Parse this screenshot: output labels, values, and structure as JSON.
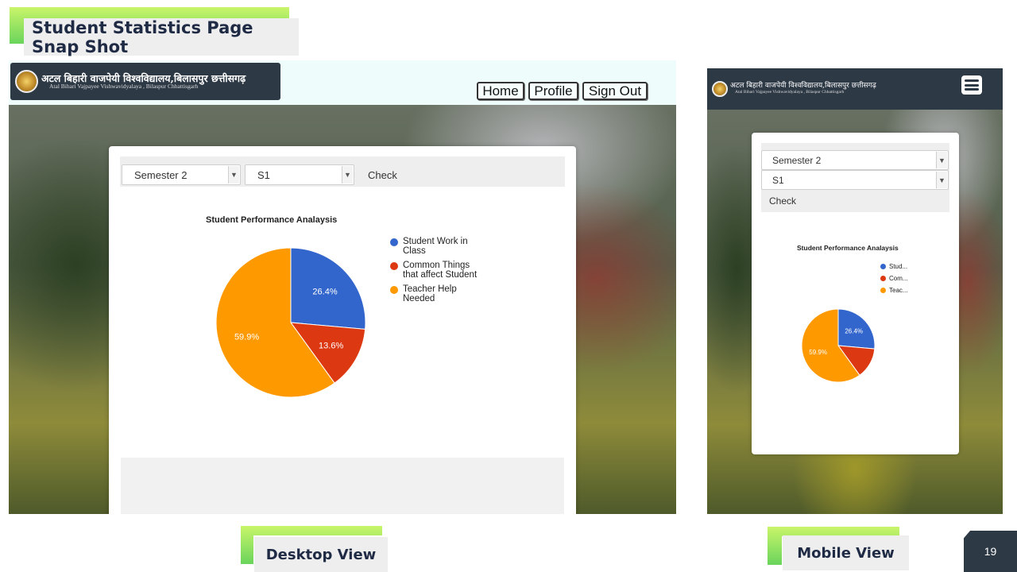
{
  "slide": {
    "title": "Student Statistics Page Snap Shot",
    "desktop_caption": "Desktop View",
    "mobile_caption": "Mobile View",
    "page_number": "19"
  },
  "site": {
    "name_hindi": "अटल बिहारी वाजपेयी विश्वविद्यालय,बिलासपुर छत्तीसगढ़",
    "name_english": "Atal Bihari Vajpayee Vishwavidyalaya , Bilaspur Chhattisgarh",
    "nav": {
      "home": "Home",
      "profile": "Profile",
      "sign_out": "Sign Out"
    }
  },
  "filters": {
    "semester": "Semester 2",
    "section": "S1",
    "check_label": "Check"
  },
  "mobile_legend": [
    "Stud...",
    "Com...",
    "Teac..."
  ],
  "colors": {
    "blue": "#3366cc",
    "red": "#dc3912",
    "orange": "#ff9900",
    "accent_green": "#6ad45c",
    "header_dark": "#2e3946"
  },
  "icons": {
    "menu": "hamburger-icon",
    "dropdown": "chevron-down-icon",
    "logo": "university-emblem"
  },
  "chart_data": [
    {
      "type": "pie",
      "view": "desktop",
      "title": "Student Performance Analaysis",
      "labels": [
        "Student Work in Class",
        "Common Things that affect Student",
        "Teacher Help Needed"
      ],
      "values": [
        26.4,
        13.6,
        59.9
      ],
      "value_labels": [
        "26.4%",
        "13.6%",
        "59.9%"
      ],
      "colors": [
        "#3366cc",
        "#dc3912",
        "#ff9900"
      ],
      "legend_position": "right"
    },
    {
      "type": "pie",
      "view": "mobile",
      "title": "Student Performance Analaysis",
      "labels": [
        "Stud...",
        "Com...",
        "Teac..."
      ],
      "values": [
        26.4,
        13.6,
        59.9
      ],
      "value_labels": [
        "26.4%",
        "",
        "59.9%"
      ],
      "colors": [
        "#3366cc",
        "#dc3912",
        "#ff9900"
      ],
      "legend_position": "top-right"
    }
  ]
}
